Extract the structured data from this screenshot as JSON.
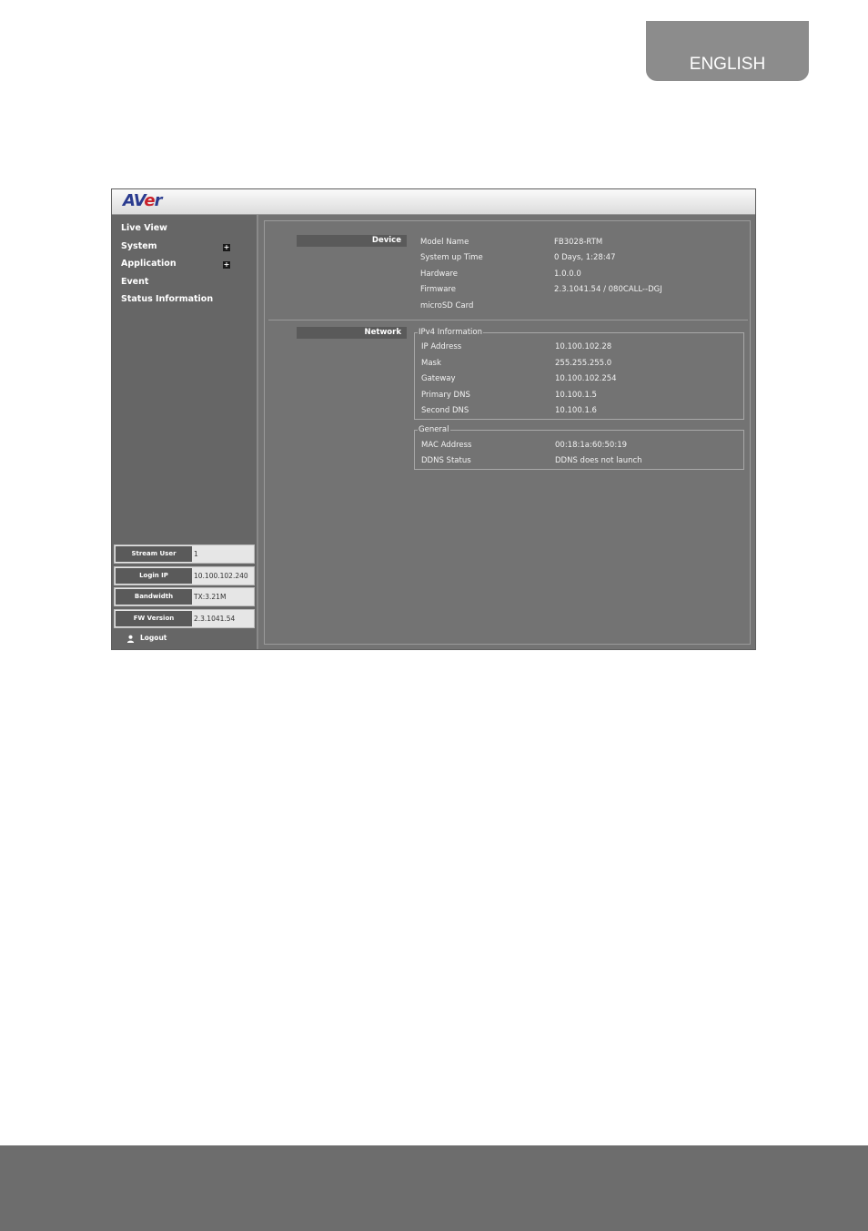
{
  "page": {
    "language_tab": "ENGLISH"
  },
  "app": {
    "logo_text_a": "AV",
    "logo_text_e": "e",
    "logo_text_r": "r"
  },
  "sidebar": {
    "items": [
      {
        "label": "Live View"
      },
      {
        "label": "System",
        "expand": "+"
      },
      {
        "label": "Application",
        "expand": "+"
      },
      {
        "label": "Event"
      },
      {
        "label": "Status Information"
      }
    ],
    "info": [
      {
        "label": "Stream User",
        "value": "1"
      },
      {
        "label": "Login IP",
        "value": "10.100.102.240"
      },
      {
        "label": "Bandwidth",
        "value": "TX:3.21M"
      },
      {
        "label": "FW Version",
        "value": "2.3.1041.54"
      }
    ],
    "logout_label": "Logout"
  },
  "device": {
    "title": "Device",
    "rows": [
      {
        "key": "Model Name",
        "value": "FB3028-RTM"
      },
      {
        "key": "System up Time",
        "value": "0 Days, 1:28:47"
      },
      {
        "key": "Hardware",
        "value": "1.0.0.0"
      },
      {
        "key": "Firmware",
        "value": "2.3.1041.54 / 080CALL--DGJ"
      },
      {
        "key": "microSD Card",
        "value": ""
      }
    ]
  },
  "network": {
    "title": "Network",
    "ipv4": {
      "legend": "IPv4 Information",
      "rows": [
        {
          "key": "IP Address",
          "value": "10.100.102.28"
        },
        {
          "key": "Mask",
          "value": "255.255.255.0"
        },
        {
          "key": "Gateway",
          "value": "10.100.102.254"
        },
        {
          "key": "Primary DNS",
          "value": "10.100.1.5"
        },
        {
          "key": "Second DNS",
          "value": "10.100.1.6"
        }
      ]
    },
    "general": {
      "legend": "General",
      "rows": [
        {
          "key": "MAC Address",
          "value": "00:18:1a:60:50:19"
        },
        {
          "key": "DDNS Status",
          "value": "DDNS does not launch"
        }
      ]
    }
  }
}
